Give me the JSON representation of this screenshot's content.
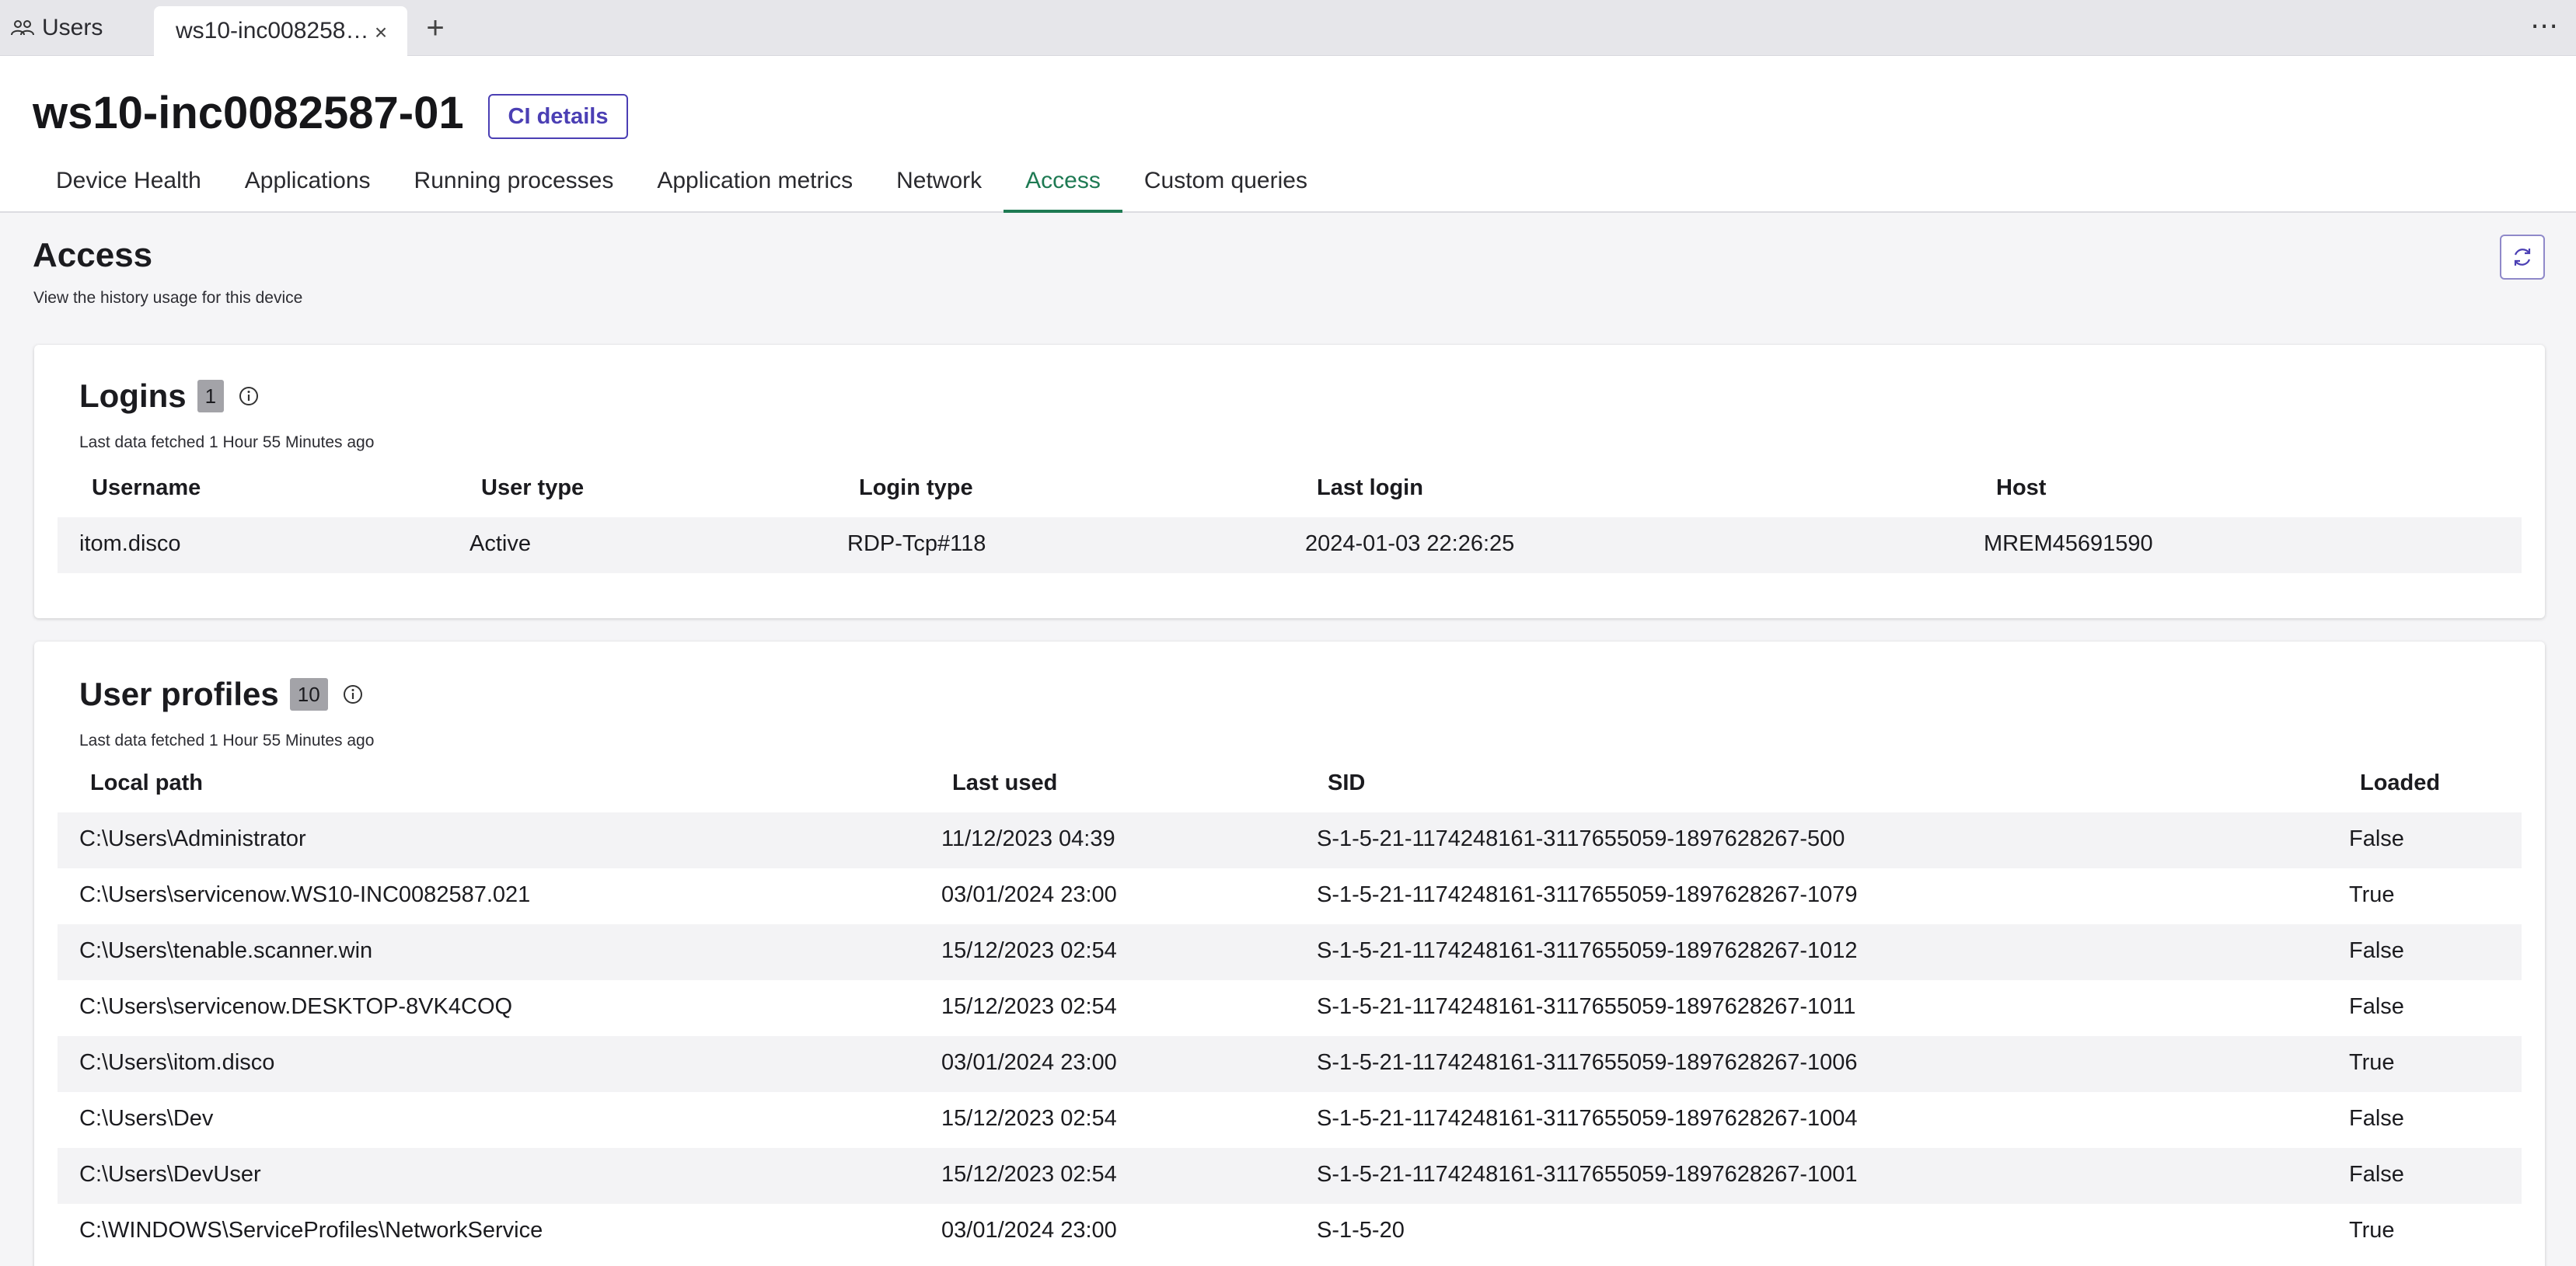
{
  "tabs": {
    "users_label": "Users",
    "active_label": "ws10-inc008258…",
    "close_glyph": "×",
    "add_glyph": "+",
    "more_glyph": "⋯"
  },
  "header": {
    "title": "ws10-inc0082587-01",
    "ci_button": "CI details",
    "nav": [
      "Device Health",
      "Applications",
      "Running processes",
      "Application metrics",
      "Network",
      "Access",
      "Custom queries"
    ],
    "active_nav": "Access"
  },
  "access": {
    "title": "Access",
    "subtitle": "View the history usage for this device"
  },
  "logins": {
    "title": "Logins",
    "count": "1",
    "fetched": "Last data fetched 1 Hour 55 Minutes ago",
    "columns": [
      "Username",
      "User type",
      "Login type",
      "Last login",
      "Host"
    ],
    "rows": [
      [
        "itom.disco",
        "Active",
        "RDP-Tcp#118",
        "2024-01-03 22:26:25",
        "MREM45691590"
      ]
    ]
  },
  "profiles": {
    "title": "User profiles",
    "count": "10",
    "fetched": "Last data fetched 1 Hour 55 Minutes ago",
    "columns": [
      "Local path",
      "Last used",
      "SID",
      "Loaded"
    ],
    "rows": [
      [
        "C:\\Users\\Administrator",
        "11/12/2023 04:39",
        "S-1-5-21-1174248161-3117655059-1897628267-500",
        "False"
      ],
      [
        "C:\\Users\\servicenow.WS10-INC0082587.021",
        "03/01/2024 23:00",
        "S-1-5-21-1174248161-3117655059-1897628267-1079",
        "True"
      ],
      [
        "C:\\Users\\tenable.scanner.win",
        "15/12/2023 02:54",
        "S-1-5-21-1174248161-3117655059-1897628267-1012",
        "False"
      ],
      [
        "C:\\Users\\servicenow.DESKTOP-8VK4COQ",
        "15/12/2023 02:54",
        "S-1-5-21-1174248161-3117655059-1897628267-1011",
        "False"
      ],
      [
        "C:\\Users\\itom.disco",
        "03/01/2024 23:00",
        "S-1-5-21-1174248161-3117655059-1897628267-1006",
        "True"
      ],
      [
        "C:\\Users\\Dev",
        "15/12/2023 02:54",
        "S-1-5-21-1174248161-3117655059-1897628267-1004",
        "False"
      ],
      [
        "C:\\Users\\DevUser",
        "15/12/2023 02:54",
        "S-1-5-21-1174248161-3117655059-1897628267-1001",
        "False"
      ],
      [
        "C:\\WINDOWS\\ServiceProfiles\\NetworkService",
        "03/01/2024 23:00",
        "S-1-5-20",
        "True"
      ]
    ]
  },
  "colors": {
    "accent": "#4b3fb4",
    "active_tab": "#1e7a53",
    "badge": "#a3a3a8"
  },
  "icons": {
    "users": "users-group-icon",
    "info": "info-circle-icon",
    "refresh": "refresh-icon"
  }
}
